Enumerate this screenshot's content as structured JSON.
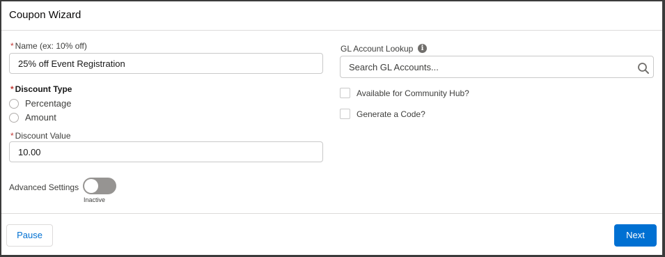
{
  "modal": {
    "title": "Coupon Wizard"
  },
  "form": {
    "name": {
      "label": "Name (ex: 10% off)",
      "value": "25% off Event Registration",
      "required_mark": "*"
    },
    "discount_type": {
      "label": "Discount Type",
      "required_mark": "*",
      "options": [
        {
          "label": "Percentage"
        },
        {
          "label": "Amount"
        }
      ]
    },
    "discount_value": {
      "label": "Discount Value",
      "value": "10.00",
      "required_mark": "*"
    },
    "advanced_settings": {
      "label": "Advanced Settings",
      "state": "Inactive",
      "on": false
    },
    "gl_account": {
      "label": "GL Account Lookup",
      "placeholder": "Search GL Accounts...",
      "info_icon": "info-icon",
      "search_icon": "search-icon"
    },
    "community_hub": {
      "label": "Available for Community Hub?",
      "checked": false
    },
    "generate_code": {
      "label": "Generate a Code?",
      "checked": false
    }
  },
  "footer": {
    "pause_label": "Pause",
    "next_label": "Next"
  },
  "colors": {
    "brand": "#0070d2",
    "required": "#c23934",
    "toggle_off": "#969492"
  }
}
